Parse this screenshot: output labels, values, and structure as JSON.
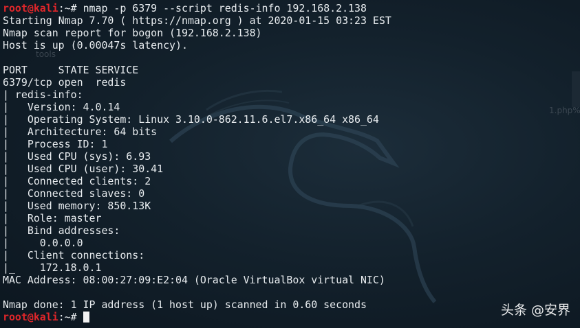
{
  "terminal": {
    "prompt_user": "root@kali",
    "prompt_path": ":~# ",
    "lines": [
      {
        "prompt": true,
        "text": "nmap -p 6379 --script redis-info 192.168.2.138"
      },
      {
        "prompt": false,
        "text": "Starting Nmap 7.70 ( https://nmap.org ) at 2020-01-15 03:23 EST"
      },
      {
        "prompt": false,
        "text": "Nmap scan report for bogon (192.168.2.138)"
      },
      {
        "prompt": false,
        "text": "Host is up (0.00047s latency)."
      },
      {
        "prompt": false,
        "text": ""
      },
      {
        "prompt": false,
        "text": "PORT     STATE SERVICE"
      },
      {
        "prompt": false,
        "text": "6379/tcp open  redis"
      },
      {
        "prompt": false,
        "text": "| redis-info:"
      },
      {
        "prompt": false,
        "text": "|   Version: 4.0.14"
      },
      {
        "prompt": false,
        "text": "|   Operating System: Linux 3.10.0-862.11.6.el7.x86_64 x86_64"
      },
      {
        "prompt": false,
        "text": "|   Architecture: 64 bits"
      },
      {
        "prompt": false,
        "text": "|   Process ID: 1"
      },
      {
        "prompt": false,
        "text": "|   Used CPU (sys): 6.93"
      },
      {
        "prompt": false,
        "text": "|   Used CPU (user): 30.41"
      },
      {
        "prompt": false,
        "text": "|   Connected clients: 2"
      },
      {
        "prompt": false,
        "text": "|   Connected slaves: 0"
      },
      {
        "prompt": false,
        "text": "|   Used memory: 850.13K"
      },
      {
        "prompt": false,
        "text": "|   Role: master"
      },
      {
        "prompt": false,
        "text": "|   Bind addresses:"
      },
      {
        "prompt": false,
        "text": "|     0.0.0.0"
      },
      {
        "prompt": false,
        "text": "|   Client connections:"
      },
      {
        "prompt": false,
        "text": "|_    172.18.0.1"
      },
      {
        "prompt": false,
        "text": "MAC Address: 08:00:27:09:E2:04 (Oracle VirtualBox virtual NIC)"
      },
      {
        "prompt": false,
        "text": ""
      },
      {
        "prompt": false,
        "text": "Nmap done: 1 IP address (1 host up) scanned in 0.60 seconds"
      },
      {
        "prompt": true,
        "text": "",
        "cursor": true
      }
    ]
  },
  "desktop_ghosts": {
    "tools_label": "tools",
    "file_label": "1.php%"
  },
  "watermark": "头条 @安界",
  "colors": {
    "prompt": "#e0262a",
    "text": "#e9edf0",
    "background": "#13212c"
  },
  "icons": [
    "kali-dragon-icon"
  ]
}
